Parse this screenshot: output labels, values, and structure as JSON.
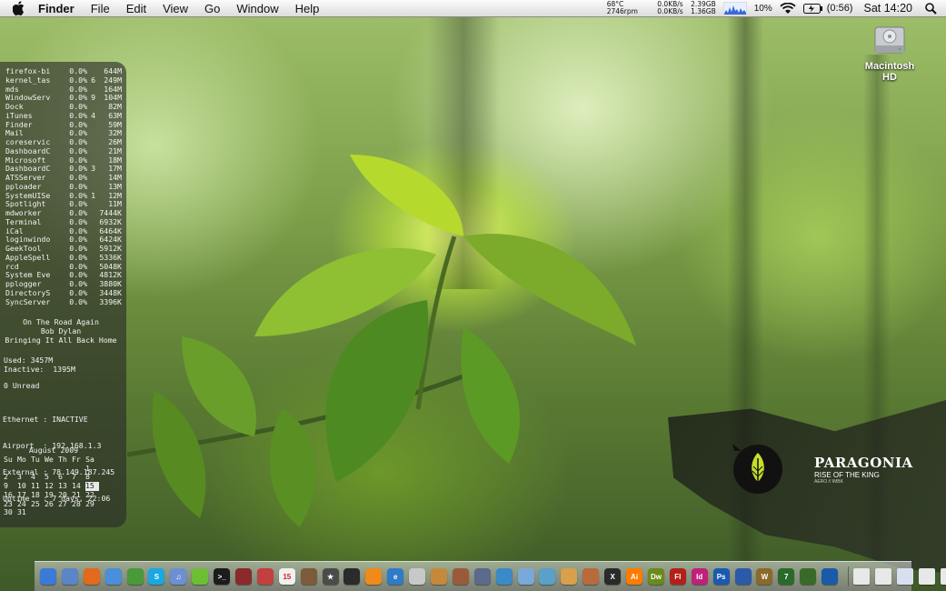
{
  "menubar": {
    "app_name": "Finder",
    "menus": [
      "File",
      "Edit",
      "View",
      "Go",
      "Window",
      "Help"
    ],
    "temp": "68°C",
    "fan": "2746rpm",
    "net_up": "0.0KB/s",
    "net_down": "0.0KB/s",
    "disk_read": "2.39GB",
    "disk_write": "1.36GB",
    "battery_percent": "10%",
    "battery_time": "(0:56)",
    "clock": "Sat 14:20"
  },
  "desktop": {
    "hd_label": "Macintosh HD"
  },
  "geektool": {
    "processes": [
      {
        "name": "firefox-bi",
        "cpu": "0.0%",
        "th": "",
        "mem": "644M"
      },
      {
        "name": "kernel_tas",
        "cpu": "0.0%",
        "th": "6",
        "mem": "249M"
      },
      {
        "name": "mds",
        "cpu": "0.0%",
        "th": "",
        "mem": "164M"
      },
      {
        "name": "WindowServ",
        "cpu": "0.0%",
        "th": "9",
        "mem": "104M"
      },
      {
        "name": "Dock",
        "cpu": "0.0%",
        "th": "",
        "mem": "82M"
      },
      {
        "name": "iTunes",
        "cpu": "0.0%",
        "th": "4",
        "mem": "63M"
      },
      {
        "name": "Finder",
        "cpu": "0.0%",
        "th": "",
        "mem": "59M"
      },
      {
        "name": "Mail",
        "cpu": "0.0%",
        "th": "",
        "mem": "32M"
      },
      {
        "name": "coreservic",
        "cpu": "0.0%",
        "th": "",
        "mem": "26M"
      },
      {
        "name": "DashboardC",
        "cpu": "0.0%",
        "th": "",
        "mem": "21M"
      },
      {
        "name": "Microsoft",
        "cpu": "0.0%",
        "th": "",
        "mem": "18M"
      },
      {
        "name": "DashboardC",
        "cpu": "0.0%",
        "th": "3",
        "mem": "17M"
      },
      {
        "name": "ATSServer",
        "cpu": "0.0%",
        "th": "",
        "mem": "14M"
      },
      {
        "name": "pploader",
        "cpu": "0.0%",
        "th": "",
        "mem": "13M"
      },
      {
        "name": "SystemUISe",
        "cpu": "0.0%",
        "th": "1",
        "mem": "12M"
      },
      {
        "name": "Spotlight",
        "cpu": "0.0%",
        "th": "",
        "mem": "11M"
      },
      {
        "name": "mdworker",
        "cpu": "0.0%",
        "th": "",
        "mem": "7444K"
      },
      {
        "name": "Terminal",
        "cpu": "0.0%",
        "th": "",
        "mem": "6932K"
      },
      {
        "name": "iCal",
        "cpu": "0.0%",
        "th": "",
        "mem": "6464K"
      },
      {
        "name": "loginwindo",
        "cpu": "0.0%",
        "th": "",
        "mem": "6424K"
      },
      {
        "name": "GeekTool",
        "cpu": "0.0%",
        "th": "",
        "mem": "5912K"
      },
      {
        "name": "AppleSpell",
        "cpu": "0.0%",
        "th": "",
        "mem": "5336K"
      },
      {
        "name": "rcd",
        "cpu": "0.0%",
        "th": "",
        "mem": "5048K"
      },
      {
        "name": "System Eve",
        "cpu": "0.0%",
        "th": "",
        "mem": "4812K"
      },
      {
        "name": "pplogger",
        "cpu": "0.0%",
        "th": "",
        "mem": "3880K"
      },
      {
        "name": "DirectoryS",
        "cpu": "0.0%",
        "th": "",
        "mem": "3448K"
      },
      {
        "name": "SyncServer",
        "cpu": "0.0%",
        "th": "",
        "mem": "3396K"
      }
    ],
    "song": {
      "title": "On The Road Again",
      "artist": "Bob Dylan",
      "album": "Bringing It All Back Home"
    },
    "memory": {
      "used": "Used: 3457M",
      "inactive": "Inactive:  1395M"
    },
    "mail": "0 Unread",
    "network": {
      "ethernet": "Ethernet : INACTIVE",
      "airport": "Airport  : 192.168.1.3",
      "external": "External : 78.149.187.245",
      "uptime": "Uptime   : 7 days, 22:06"
    },
    "calendar": {
      "caption": "August 2009",
      "weekdays": [
        "Su",
        "Mo",
        "Tu",
        "We",
        "Th",
        "Fr",
        "Sa"
      ],
      "days": [
        "",
        "",
        "",
        "",
        "",
        "",
        "1",
        "2",
        "3",
        "4",
        "5",
        "6",
        "7",
        "8",
        "9",
        "10",
        "11",
        "12",
        "13",
        "14",
        "15",
        "16",
        "17",
        "18",
        "19",
        "20",
        "21",
        "22",
        "23",
        "24",
        "25",
        "26",
        "27",
        "28",
        "29",
        "30",
        "31",
        "",
        "",
        "",
        "",
        ""
      ],
      "today": "15"
    }
  },
  "watermark": {
    "title": "PARAGONIA",
    "subtitle": "RISE OF THE KING",
    "credit": "AERO // IMBK"
  },
  "dock": {
    "items": [
      {
        "icon": "finder-icon",
        "color": "#3b7bd8",
        "text": ""
      },
      {
        "icon": "preview-icon",
        "color": "#5a86c8",
        "text": ""
      },
      {
        "icon": "firefox-icon",
        "color": "#e36a1a",
        "text": ""
      },
      {
        "icon": "safari-icon",
        "color": "#4b8fdc",
        "text": ""
      },
      {
        "icon": "adium-icon",
        "color": "#4a9a3a",
        "text": ""
      },
      {
        "icon": "skype-icon",
        "color": "#19a8e2",
        "text": "S"
      },
      {
        "icon": "itunes-icon",
        "color": "#6d8fd4",
        "text": "♫"
      },
      {
        "icon": "spotify-icon",
        "color": "#6cbf34",
        "text": ""
      },
      {
        "icon": "terminal-icon",
        "color": "#1c1c1c",
        "text": ">_"
      },
      {
        "icon": "photo-booth-icon",
        "color": "#8a2a2a",
        "text": ""
      },
      {
        "icon": "ichat-icon",
        "color": "#c24040",
        "text": ""
      },
      {
        "icon": "ical-icon",
        "color": "#f0f0f0",
        "text": "15"
      },
      {
        "icon": "iphoto-icon",
        "color": "#7d5a3c",
        "text": ""
      },
      {
        "icon": "imovie-icon",
        "color": "#4b4b4b",
        "text": "★"
      },
      {
        "icon": "final-cut-icon",
        "color": "#2b2b2b",
        "text": ""
      },
      {
        "icon": "vlc-icon",
        "color": "#f08a1a",
        "text": ""
      },
      {
        "icon": "ie-icon",
        "color": "#2f7bc8",
        "text": "e"
      },
      {
        "icon": "ipod-icon",
        "color": "#c8c8c8",
        "text": ""
      },
      {
        "icon": "garageband-icon",
        "color": "#c48a3a",
        "text": ""
      },
      {
        "icon": "keynote-icon",
        "color": "#9a5a3a",
        "text": ""
      },
      {
        "icon": "pen-icon",
        "color": "#5a6a8a",
        "text": ""
      },
      {
        "icon": "graph-icon",
        "color": "#3a8ac8",
        "text": ""
      },
      {
        "icon": "mail-icon",
        "color": "#7aa8d8",
        "text": ""
      },
      {
        "icon": "stack-icon",
        "color": "#5aa0c8",
        "text": ""
      },
      {
        "icon": "folder-icon",
        "color": "#d8a04a",
        "text": ""
      },
      {
        "icon": "tools-icon",
        "color": "#b86a3a",
        "text": ""
      },
      {
        "icon": "xbox-icon",
        "color": "#2a2a2a",
        "text": "X"
      },
      {
        "icon": "illustrator-icon",
        "color": "#ff7c00",
        "text": "Ai"
      },
      {
        "icon": "dreamweaver-icon",
        "color": "#6a8a1a",
        "text": "Dw"
      },
      {
        "icon": "flash-icon",
        "color": "#b3201a",
        "text": "Fl"
      },
      {
        "icon": "indesign-icon",
        "color": "#c0207a",
        "text": "Id"
      },
      {
        "icon": "photoshop-icon",
        "color": "#1a5ab0",
        "text": "Ps"
      },
      {
        "icon": "globe-icon",
        "color": "#2a5aa8",
        "text": ""
      },
      {
        "icon": "wow-icon",
        "color": "#8a6a2a",
        "text": "W"
      },
      {
        "icon": "coda-icon",
        "color": "#2a6a2a",
        "text": "7"
      },
      {
        "icon": "plant-icon",
        "color": "#3a6a2a",
        "text": ""
      },
      {
        "icon": "download-icon",
        "color": "#1a5aa8",
        "text": ""
      }
    ],
    "stacks": [
      {
        "icon": "document-stack-icon",
        "color": "#e8e8e8"
      },
      {
        "icon": "document-stack-icon",
        "color": "#e8e8e8"
      },
      {
        "icon": "document-stack-icon",
        "color": "#d8e0f0"
      },
      {
        "icon": "document-stack-icon",
        "color": "#e8e8e8"
      },
      {
        "icon": "document-stack-icon",
        "color": "#e8e8e8"
      },
      {
        "icon": "trash-icon",
        "color": "#b8b8b8"
      }
    ]
  }
}
